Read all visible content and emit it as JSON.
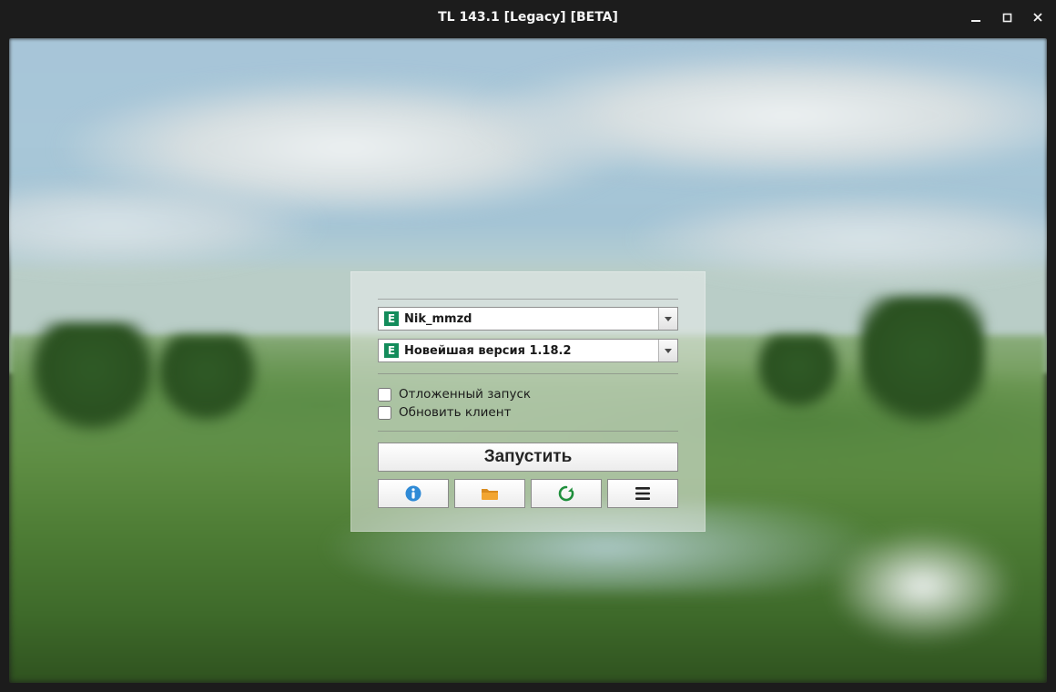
{
  "window": {
    "title": "TL 143.1 [Legacy] [BETA]"
  },
  "panel": {
    "account": {
      "badge": "E",
      "label": "Nik_mmzd"
    },
    "version": {
      "badge": "E",
      "label": "Новейшая версия 1.18.2"
    },
    "delayed_launch_label": "Отложенный запуск",
    "update_client_label": "Обновить клиент",
    "launch_label": "Запустить"
  },
  "icons": {
    "info": "info-icon",
    "folder": "folder-icon",
    "refresh": "refresh-icon",
    "menu": "hamburger-icon"
  }
}
